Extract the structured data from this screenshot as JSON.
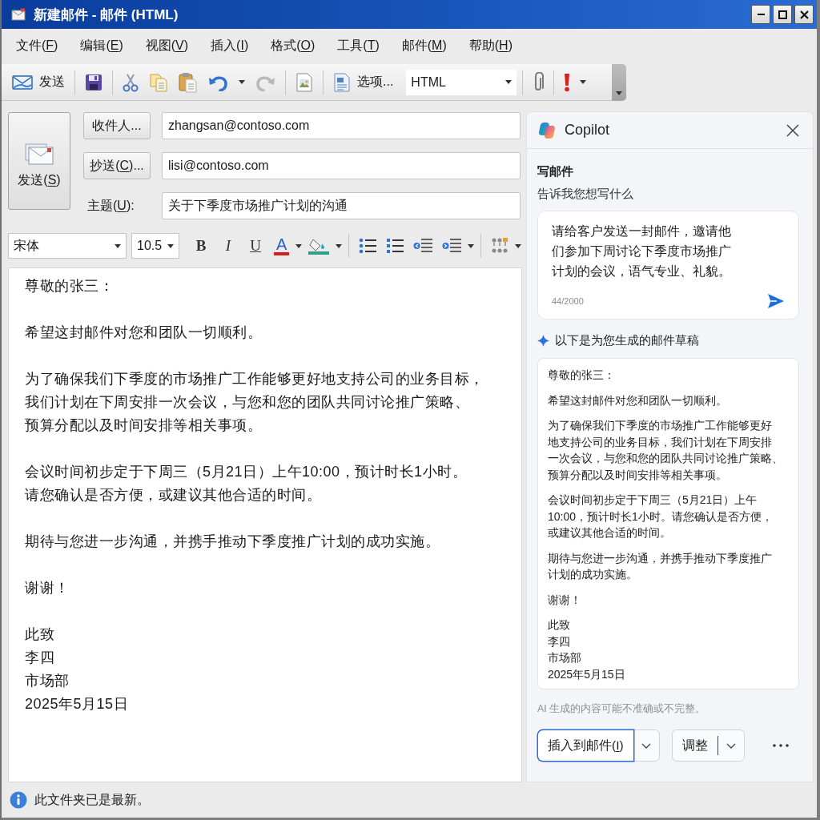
{
  "window": {
    "title": "新建邮件 - 邮件 (HTML)"
  },
  "menu": [
    {
      "pre": "文件(",
      "key": "F",
      "post": ")"
    },
    {
      "pre": "编辑(",
      "key": "E",
      "post": ")"
    },
    {
      "pre": "视图(",
      "key": "V",
      "post": ")"
    },
    {
      "pre": "插入(",
      "key": "I",
      "post": ")"
    },
    {
      "pre": "格式(",
      "key": "O",
      "post": ")"
    },
    {
      "pre": "工具(",
      "key": "T",
      "post": ")"
    },
    {
      "pre": "邮件(",
      "key": "M",
      "post": ")"
    },
    {
      "pre": "帮助(",
      "key": "H",
      "post": ")"
    }
  ],
  "toolbar": {
    "send": "发送",
    "redo": {
      "disabled": true
    },
    "options": "选项...",
    "format": "HTML"
  },
  "header": {
    "send_button": {
      "pre": "发送(",
      "key": "S",
      "post": ")"
    },
    "fields": [
      {
        "kind": "button",
        "label": {
          "pre": "收件人..."
        },
        "value": "zhangsan@contoso.com"
      },
      {
        "kind": "button",
        "label": {
          "pre": "抄送(",
          "key": "C",
          "post": ")..."
        },
        "value": "lisi@contoso.com"
      },
      {
        "kind": "label",
        "label": {
          "pre": "主题(",
          "key": "U",
          "post": "):"
        },
        "value": "关于下季度市场推广计划的沟通"
      }
    ]
  },
  "format_bar": {
    "font": "宋体",
    "size": "10.5",
    "bold": "B",
    "italic": "I",
    "underline": "U",
    "font_color": "A"
  },
  "body": [
    {
      "lines": [
        "尊敬的张三："
      ]
    },
    {
      "lines": [
        "希望这封邮件对您和团队一切顺利。"
      ]
    },
    {
      "lines": [
        "为了确保我们下季度的市场推广工作能够更好地支持公司的业务目标，",
        "我们计划在下周安排一次会议，与您和您的团队共同讨论推广策略、",
        "预算分配以及时间安排等相关事项。"
      ]
    },
    {
      "lines": [
        "会议时间初步定于下周三（5月21日）上午10:00，预计时长1小时。",
        "请您确认是否方便，或建议其他合适的时间。"
      ]
    },
    {
      "lines": [
        "期待与您进一步沟通，并携手推动下季度推广计划的成功实施。"
      ]
    },
    {
      "lines": [
        "谢谢！"
      ]
    },
    {
      "lines": [
        "此致",
        "李四",
        "市场部",
        "2025年5月15日"
      ]
    }
  ],
  "copilot": {
    "title": "Copilot",
    "heading": "写邮件",
    "subheading": "告诉我您想写什么",
    "prompt": {
      "value": "请给客户发送一封邮件，邀请他们参加下周讨论下季度市场推广计划的会议，语气专业、礼貌。",
      "counter": "44/2000"
    },
    "draft_label": "以下是为您生成的邮件草稿",
    "draft": [
      {
        "lines": [
          "尊敬的张三："
        ]
      },
      {
        "lines": [
          "希望这封邮件对您和团队一切顺利。"
        ]
      },
      {
        "lines": [
          "为了确保我们下季度的市场推广工作能够更好",
          "地支持公司的业务目标，我们计划在下周安排",
          "一次会议，与您和您的团队共同讨论推广策略、",
          "预算分配以及时间安排等相关事项。"
        ]
      },
      {
        "lines": [
          "会议时间初步定于下周三（5月21日）上午",
          "10:00，预计时长1小时。请您确认是否方便，",
          "或建议其他合适的时间。"
        ]
      },
      {
        "lines": [
          "期待与您进一步沟通，并携手推动下季度推广",
          "计划的成功实施。"
        ]
      },
      {
        "lines": [
          "谢谢！"
        ]
      },
      {
        "lines": [
          "此致",
          "李四",
          "市场部",
          "2025年5月15日"
        ]
      }
    ],
    "disclaimer": "AI 生成的内容可能不准确或不完整。",
    "actions": [
      {
        "pre": "插入到邮件(",
        "key": "I",
        "post": ")",
        "focused": true
      },
      {
        "pre": "调整",
        "focused": false
      }
    ]
  },
  "status_bar": {
    "text": "此文件夹已是最新。"
  }
}
